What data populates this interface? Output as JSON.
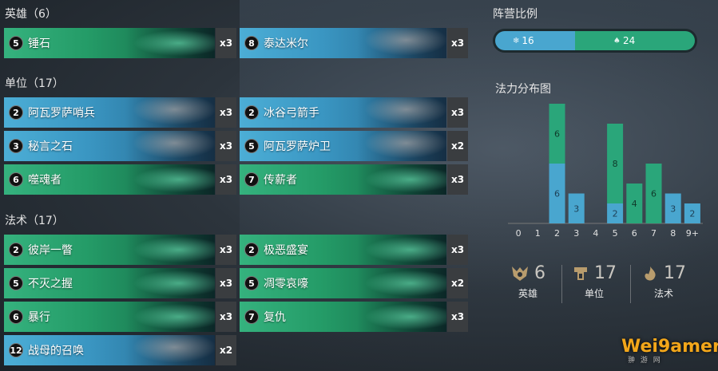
{
  "sections": {
    "heroes_title": "英雄（6）",
    "units_title": "单位（17）",
    "spells_title": "法术（17）"
  },
  "heroes": [
    {
      "cost": "5",
      "name": "锤石",
      "count": "x3",
      "color": "green"
    },
    {
      "cost": "8",
      "name": "泰达米尔",
      "count": "x3",
      "color": "blue"
    }
  ],
  "units": [
    {
      "cost": "2",
      "name": "阿瓦罗萨哨兵",
      "count": "x3",
      "color": "blue"
    },
    {
      "cost": "2",
      "name": "冰谷弓箭手",
      "count": "x3",
      "color": "blue"
    },
    {
      "cost": "3",
      "name": "秘言之石",
      "count": "x3",
      "color": "blue"
    },
    {
      "cost": "5",
      "name": "阿瓦罗萨炉卫",
      "count": "x2",
      "color": "blue"
    },
    {
      "cost": "6",
      "name": "噬魂者",
      "count": "x3",
      "color": "green"
    },
    {
      "cost": "7",
      "name": "传薪者",
      "count": "x3",
      "color": "green"
    }
  ],
  "spells": [
    {
      "cost": "2",
      "name": "彼岸一瞥",
      "count": "x3",
      "color": "green"
    },
    {
      "cost": "2",
      "name": "极恶盛宴",
      "count": "x3",
      "color": "green"
    },
    {
      "cost": "5",
      "name": "不灭之握",
      "count": "x3",
      "color": "green"
    },
    {
      "cost": "5",
      "name": "凋零哀嚎",
      "count": "x2",
      "color": "green"
    },
    {
      "cost": "6",
      "name": "暴行",
      "count": "x3",
      "color": "green"
    },
    {
      "cost": "7",
      "name": "复仇",
      "count": "x3",
      "color": "green"
    },
    {
      "cost": "12",
      "name": "战母的召唤",
      "count": "x2",
      "color": "blue"
    }
  ],
  "faction_ratio": {
    "title": "阵营比例",
    "freljord": {
      "value": 16,
      "icon": "freljord-icon",
      "color": "#49a6cf"
    },
    "shadow_isles": {
      "value": 24,
      "icon": "shadow-isles-icon",
      "color": "#2aa67a"
    }
  },
  "mana_title": "法力分布图",
  "chart_data": {
    "type": "bar",
    "stacked": true,
    "categories": [
      "0",
      "1",
      "2",
      "3",
      "4",
      "5",
      "6",
      "7",
      "8",
      "9+"
    ],
    "series": [
      {
        "color": "#49a6cf",
        "values": [
          0,
          0,
          6,
          3,
          0,
          2,
          0,
          0,
          3,
          2
        ]
      },
      {
        "color": "#2aa67a",
        "values": [
          0,
          0,
          6,
          0,
          0,
          8,
          4,
          6,
          0,
          0
        ]
      }
    ],
    "ylim": [
      0,
      12
    ]
  },
  "stats": [
    {
      "value": "6",
      "label": "英雄",
      "icon": "champion-icon"
    },
    {
      "value": "17",
      "label": "单位",
      "icon": "unit-icon"
    },
    {
      "value": "17",
      "label": "法术",
      "icon": "spell-icon"
    }
  ],
  "watermark": {
    "main": "Wei9amer",
    "sub": "翀 游 网"
  }
}
